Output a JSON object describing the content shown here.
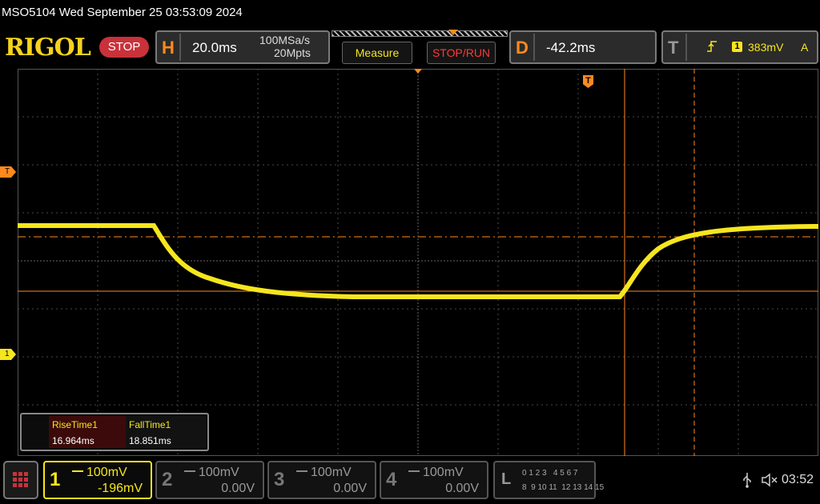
{
  "status_line": "MSO5104  Wed September 25 03:53:09 2024",
  "brand": "RIGOL",
  "run_state": "STOP",
  "horizontal": {
    "letter": "H",
    "timebase": "20.0ms",
    "sample_rate": "100MSa/s",
    "memory_depth": "20Mpts"
  },
  "buttons": {
    "measure": "Measure",
    "stop_run": "STOP/RUN"
  },
  "delay": {
    "letter": "D",
    "value": "-42.2ms"
  },
  "trigger": {
    "letter": "T",
    "source": "1",
    "level": "383mV",
    "mode": "A"
  },
  "markers": {
    "trigger_level": "T",
    "channel1": "1",
    "trigger_pos": "T"
  },
  "measurements": {
    "rise_label": "RiseTime1",
    "rise_value": "16.964ms",
    "fall_label": "FallTime1",
    "fall_value": "18.851ms"
  },
  "channels": [
    {
      "num": "1",
      "scale": "100mV",
      "offset": "-196mV"
    },
    {
      "num": "2",
      "scale": "100mV",
      "offset": "0.00V"
    },
    {
      "num": "3",
      "scale": "100mV",
      "offset": "0.00V"
    },
    {
      "num": "4",
      "scale": "100mV",
      "offset": "0.00V"
    }
  ],
  "logic": {
    "letter": "L",
    "row1": "0 1 2 3   4 5 6 7",
    "row2": "8  9 10 11  12 13 14 15"
  },
  "clock": "03:52",
  "colors": {
    "trace": "#f6e61e",
    "accent": "#ff8a1e",
    "stop": "#c9323a",
    "brand": "#f6d21e"
  }
}
